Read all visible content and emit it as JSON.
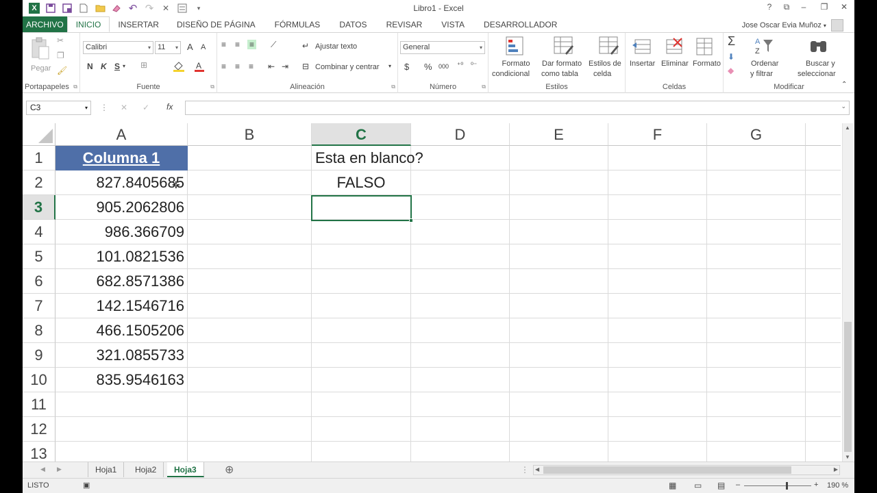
{
  "window": {
    "title": "Libro1 - Excel",
    "help": "?",
    "minimize": "–",
    "restore": "❐",
    "close": "✕",
    "ribbon_display": "⧉"
  },
  "qat": {
    "icons": [
      "excel-logo-icon",
      "save-icon",
      "save-as-icon",
      "new-icon",
      "open-icon",
      "eraser-icon",
      "undo-icon",
      "redo-icon",
      "close-small-icon",
      "form-icon",
      "customize-qat-icon"
    ],
    "undo": "↶",
    "redo": "↷",
    "close_x": "✕"
  },
  "tabs": [
    "ARCHIVO",
    "INICIO",
    "INSERTAR",
    "DISEÑO DE PÁGINA",
    "FÓRMULAS",
    "DATOS",
    "REVISAR",
    "VISTA",
    "DESARROLLADOR"
  ],
  "active_tab": "INICIO",
  "user": {
    "name": "Jose Oscar Evia Muñoz"
  },
  "ribbon": {
    "clipboard": {
      "label": "Portapapeles",
      "paste": "Pegar"
    },
    "font": {
      "label": "Fuente",
      "name": "Calibri",
      "size": "11",
      "bold": "N",
      "italic": "K",
      "underline": "S",
      "grow": "A",
      "shrink": "A"
    },
    "alignment": {
      "label": "Alineación",
      "wrap": "Ajustar texto",
      "merge": "Combinar y centrar"
    },
    "number": {
      "label": "Número",
      "format": "General",
      "currency": "$",
      "percent": "%",
      "thousands": "000"
    },
    "styles": {
      "label": "Estilos",
      "cond_format_1": "Formato",
      "cond_format_2": "condicional",
      "table_1": "Dar formato",
      "table_2": "como tabla",
      "cell_1": "Estilos de",
      "cell_2": "celda"
    },
    "cells": {
      "label": "Celdas",
      "insert": "Insertar",
      "delete": "Eliminar",
      "format": "Formato"
    },
    "editing": {
      "label": "Modificar",
      "sum": "Σ",
      "sort_1": "Ordenar",
      "sort_2": "y filtrar",
      "find_1": "Buscar y",
      "find_2": "seleccionar"
    }
  },
  "formula_bar": {
    "namebox": "C3",
    "fx": "fx",
    "cancel": "✕",
    "enter": "✓",
    "value": ""
  },
  "columns": [
    "A",
    "B",
    "C",
    "D",
    "E",
    "F",
    "G"
  ],
  "selected_column": "C",
  "rows": [
    "1",
    "2",
    "3",
    "4",
    "5",
    "6",
    "7",
    "8",
    "9",
    "10",
    "11",
    "12",
    "13"
  ],
  "selected_row": "3",
  "cells": {
    "A1": "Columna 1",
    "C1": "Esta en blanco?",
    "C2": "FALSO",
    "A_values": [
      "827.8405685",
      "905.2062806",
      "986.366709",
      "101.0821536",
      "682.8571386",
      "142.1546716",
      "466.1505206",
      "321.0855733",
      "835.9546163"
    ]
  },
  "colors": {
    "accent": "#217346",
    "header_fill": "#4f6fa8"
  },
  "sheets": [
    "Hoja1",
    "Hoja2",
    "Hoja3"
  ],
  "active_sheet": "Hoja3",
  "add_sheet": "⊕",
  "status": {
    "mode": "LISTO",
    "zoom": "190 %",
    "zoom_level": 1.9
  }
}
